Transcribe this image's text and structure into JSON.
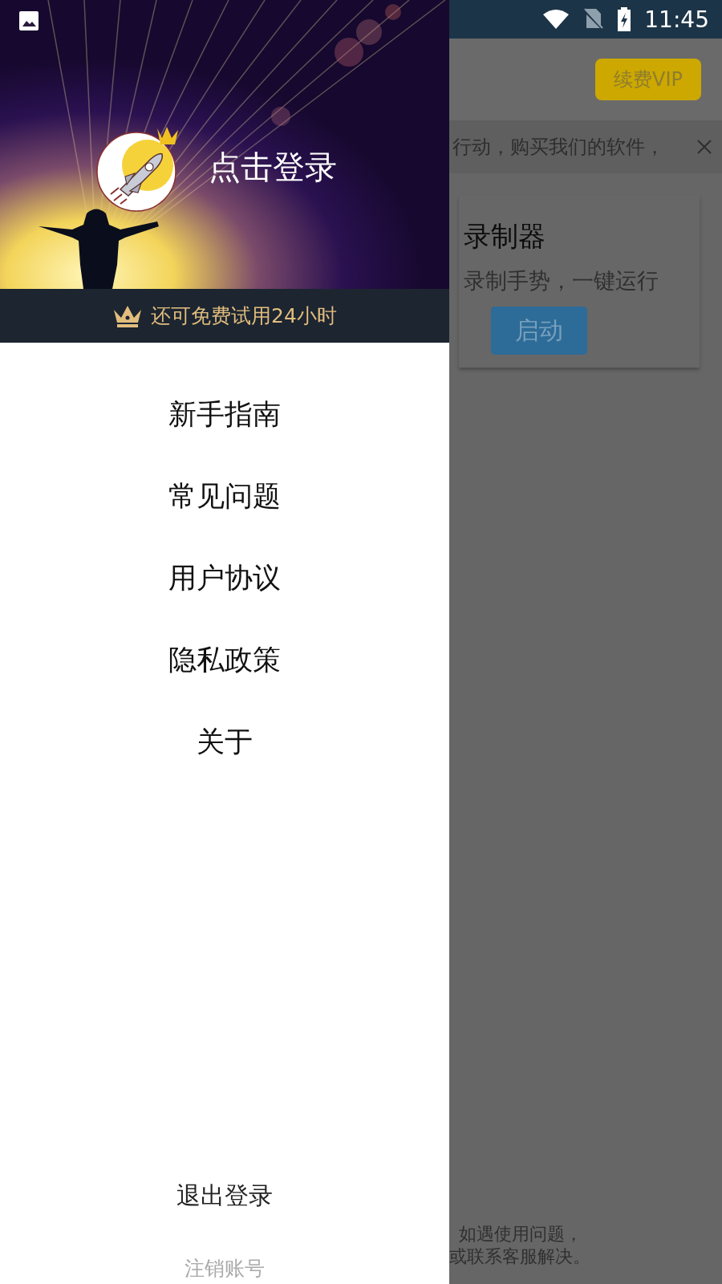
{
  "status_bar": {
    "time": "11:45"
  },
  "drawer": {
    "login_title": "点击登录",
    "trial_notice": "还可免费试用24小时",
    "menu": [
      {
        "label": "新手指南"
      },
      {
        "label": "常见问题"
      },
      {
        "label": "用户协议"
      },
      {
        "label": "隐私政策"
      },
      {
        "label": "关于"
      }
    ],
    "logout": "退出登录",
    "delete_account": "注销账号"
  },
  "main": {
    "vip_button": "续费VIP",
    "notice": "行动，购买我们的软件，",
    "card": {
      "title": "录制器",
      "description": "录制手势，一键运行",
      "button": "启动"
    },
    "help_text": [
      "如遇使用问题，",
      "或联系客服解决。"
    ]
  }
}
